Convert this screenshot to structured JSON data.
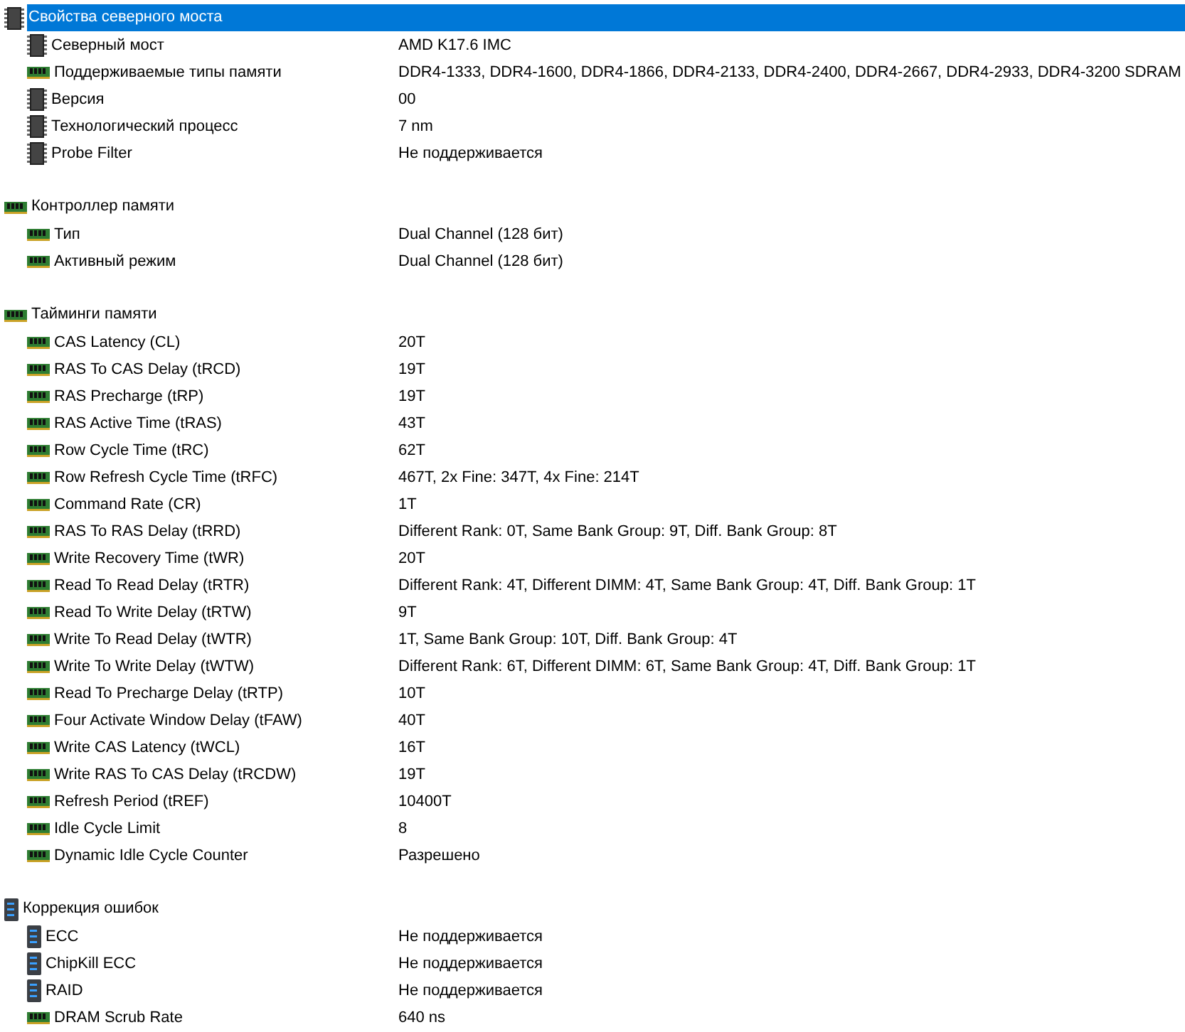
{
  "sections": [
    {
      "title": "Свойства северного моста",
      "kind": "chip",
      "selected": true,
      "items": [
        {
          "label": "Северный мост",
          "value": "AMD K17.6 IMC",
          "kind": "chip"
        },
        {
          "label": "Поддерживаемые типы памяти",
          "value": "DDR4-1333, DDR4-1600, DDR4-1866, DDR4-2133, DDR4-2400, DDR4-2667, DDR4-2933, DDR4-3200 SDRAM",
          "kind": "ram"
        },
        {
          "label": "Версия",
          "value": "00",
          "kind": "chip"
        },
        {
          "label": "Технологический процесс",
          "value": "7 nm",
          "kind": "chip"
        },
        {
          "label": "Probe Filter",
          "value": "Не поддерживается",
          "kind": "chip"
        }
      ]
    },
    {
      "title": "Контроллер памяти",
      "kind": "ram",
      "selected": false,
      "items": [
        {
          "label": "Тип",
          "value": "Dual Channel  (128 бит)",
          "kind": "ram"
        },
        {
          "label": "Активный режим",
          "value": "Dual Channel  (128 бит)",
          "kind": "ram"
        }
      ]
    },
    {
      "title": "Тайминги памяти",
      "kind": "ram",
      "selected": false,
      "items": [
        {
          "label": "CAS Latency (CL)",
          "value": "20T",
          "kind": "ram"
        },
        {
          "label": "RAS To CAS Delay (tRCD)",
          "value": "19T",
          "kind": "ram"
        },
        {
          "label": "RAS Precharge (tRP)",
          "value": "19T",
          "kind": "ram"
        },
        {
          "label": "RAS Active Time (tRAS)",
          "value": "43T",
          "kind": "ram"
        },
        {
          "label": "Row Cycle Time (tRC)",
          "value": "62T",
          "kind": "ram"
        },
        {
          "label": "Row Refresh Cycle Time (tRFC)",
          "value": "467T, 2x Fine: 347T, 4x Fine: 214T",
          "kind": "ram"
        },
        {
          "label": "Command Rate (CR)",
          "value": "1T",
          "kind": "ram"
        },
        {
          "label": "RAS To RAS Delay (tRRD)",
          "value": "Different Rank: 0T, Same Bank Group: 9T, Diff. Bank Group: 8T",
          "kind": "ram"
        },
        {
          "label": "Write Recovery Time (tWR)",
          "value": "20T",
          "kind": "ram"
        },
        {
          "label": "Read To Read Delay (tRTR)",
          "value": "Different Rank: 4T, Different DIMM: 4T, Same Bank Group: 4T, Diff. Bank Group: 1T",
          "kind": "ram"
        },
        {
          "label": "Read To Write Delay (tRTW)",
          "value": "9T",
          "kind": "ram"
        },
        {
          "label": "Write To Read Delay (tWTR)",
          "value": "1T, Same Bank Group: 10T, Diff. Bank Group: 4T",
          "kind": "ram"
        },
        {
          "label": "Write To Write Delay (tWTW)",
          "value": "Different Rank: 6T, Different DIMM: 6T, Same Bank Group: 4T, Diff. Bank Group: 1T",
          "kind": "ram"
        },
        {
          "label": "Read To Precharge Delay (tRTP)",
          "value": "10T",
          "kind": "ram"
        },
        {
          "label": "Four Activate Window Delay (tFAW)",
          "value": "40T",
          "kind": "ram"
        },
        {
          "label": "Write CAS Latency (tWCL)",
          "value": "16T",
          "kind": "ram"
        },
        {
          "label": "Write RAS To CAS Delay (tRCDW)",
          "value": "19T",
          "kind": "ram"
        },
        {
          "label": "Refresh Period (tREF)",
          "value": "10400T",
          "kind": "ram"
        },
        {
          "label": "Idle Cycle Limit",
          "value": "8",
          "kind": "ram"
        },
        {
          "label": "Dynamic Idle Cycle Counter",
          "value": "Разрешено",
          "kind": "ram"
        }
      ]
    },
    {
      "title": "Коррекция ошибок",
      "kind": "server",
      "selected": false,
      "items": [
        {
          "label": "ECC",
          "value": "Не поддерживается",
          "kind": "server"
        },
        {
          "label": "ChipKill ECC",
          "value": "Не поддерживается",
          "kind": "server"
        },
        {
          "label": "RAID",
          "value": "Не поддерживается",
          "kind": "server"
        },
        {
          "label": "DRAM Scrub Rate",
          "value": "640 ns",
          "kind": "ram"
        }
      ]
    }
  ]
}
